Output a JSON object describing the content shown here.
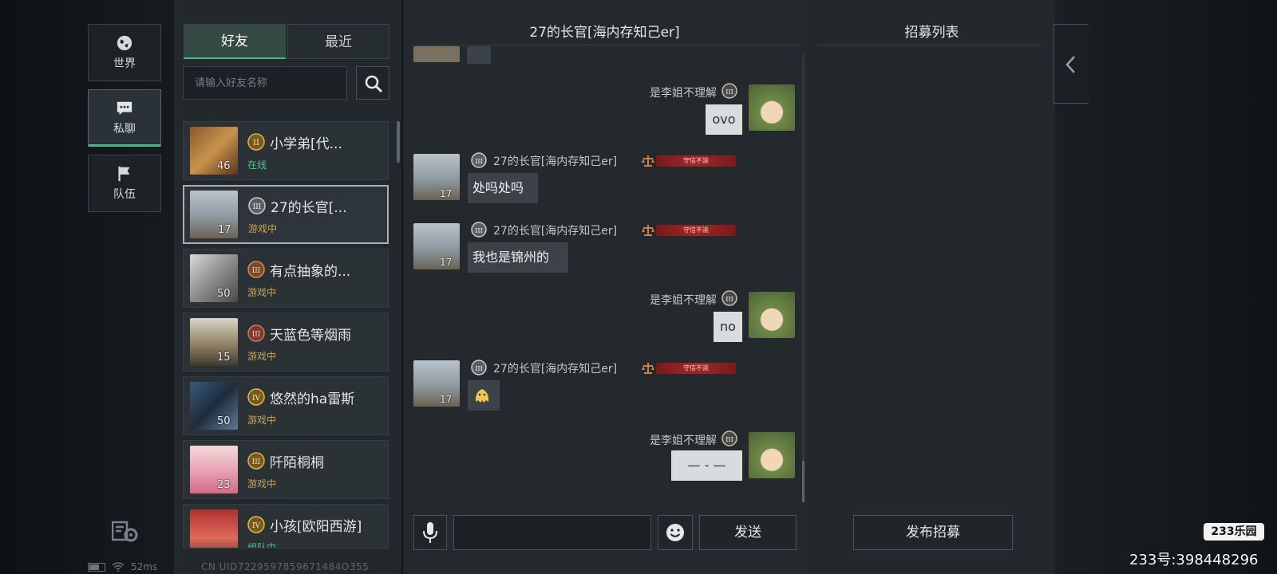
{
  "nav": {
    "world": "世界",
    "private": "私聊",
    "team": "队伍"
  },
  "status_bar": {
    "ping": "52ms"
  },
  "friends_panel": {
    "tabs": {
      "friends": "好友",
      "recent": "最近"
    },
    "search_placeholder": "请输入好友名称",
    "uid": "CN UID7229597859671484O355"
  },
  "friends": [
    {
      "name": "小学弟[代...",
      "status": "在线",
      "level": "46",
      "rank": "II"
    },
    {
      "name": "27的长官[...",
      "status": "游戏中",
      "level": "17",
      "rank": "III"
    },
    {
      "name": "有点抽象的...",
      "status": "游戏中",
      "level": "50",
      "rank": "III"
    },
    {
      "name": "天蓝色等烟雨",
      "status": "游戏中",
      "level": "15",
      "rank": "III"
    },
    {
      "name": "悠然的ha雷斯",
      "status": "游戏中",
      "level": "50",
      "rank": "IV"
    },
    {
      "name": "阡陌桐桐",
      "status": "游戏中",
      "level": "23",
      "rank": "III"
    },
    {
      "name": "小孩[欧阳西游]",
      "status": "组队中",
      "level": "",
      "rank": "IV"
    }
  ],
  "chat": {
    "title": "27的长官[海内存知己er]",
    "input_value": "",
    "send_label": "发送",
    "messages": [
      {
        "from": "是李姐不理解",
        "me": true,
        "text": "ovo"
      },
      {
        "from": "27的长官[海内存知己er]",
        "me": false,
        "text": "处吗处吗",
        "level": "17",
        "tag": "守信不渝"
      },
      {
        "from": "27的长官[海内存知己er]",
        "me": false,
        "text": "我也是锦州的",
        "level": "17",
        "tag": "守信不渝"
      },
      {
        "from": "是李姐不理解",
        "me": true,
        "text": "no"
      },
      {
        "from": "27的长官[海内存知己er]",
        "me": false,
        "text": "",
        "level": "17",
        "tag": "守信不渝"
      },
      {
        "from": "是李姐不理解",
        "me": true,
        "text": "— - —"
      }
    ]
  },
  "recruit": {
    "title": "招募列表",
    "publish_label": "发布招募"
  },
  "watermark": {
    "logo": "233乐园",
    "text": "233号:398448296"
  },
  "colors": {
    "accent_green": "#3fbf7f",
    "status_ingame": "#c9a84c",
    "status_online": "#4cc88a",
    "tag_red": "#a02626"
  }
}
